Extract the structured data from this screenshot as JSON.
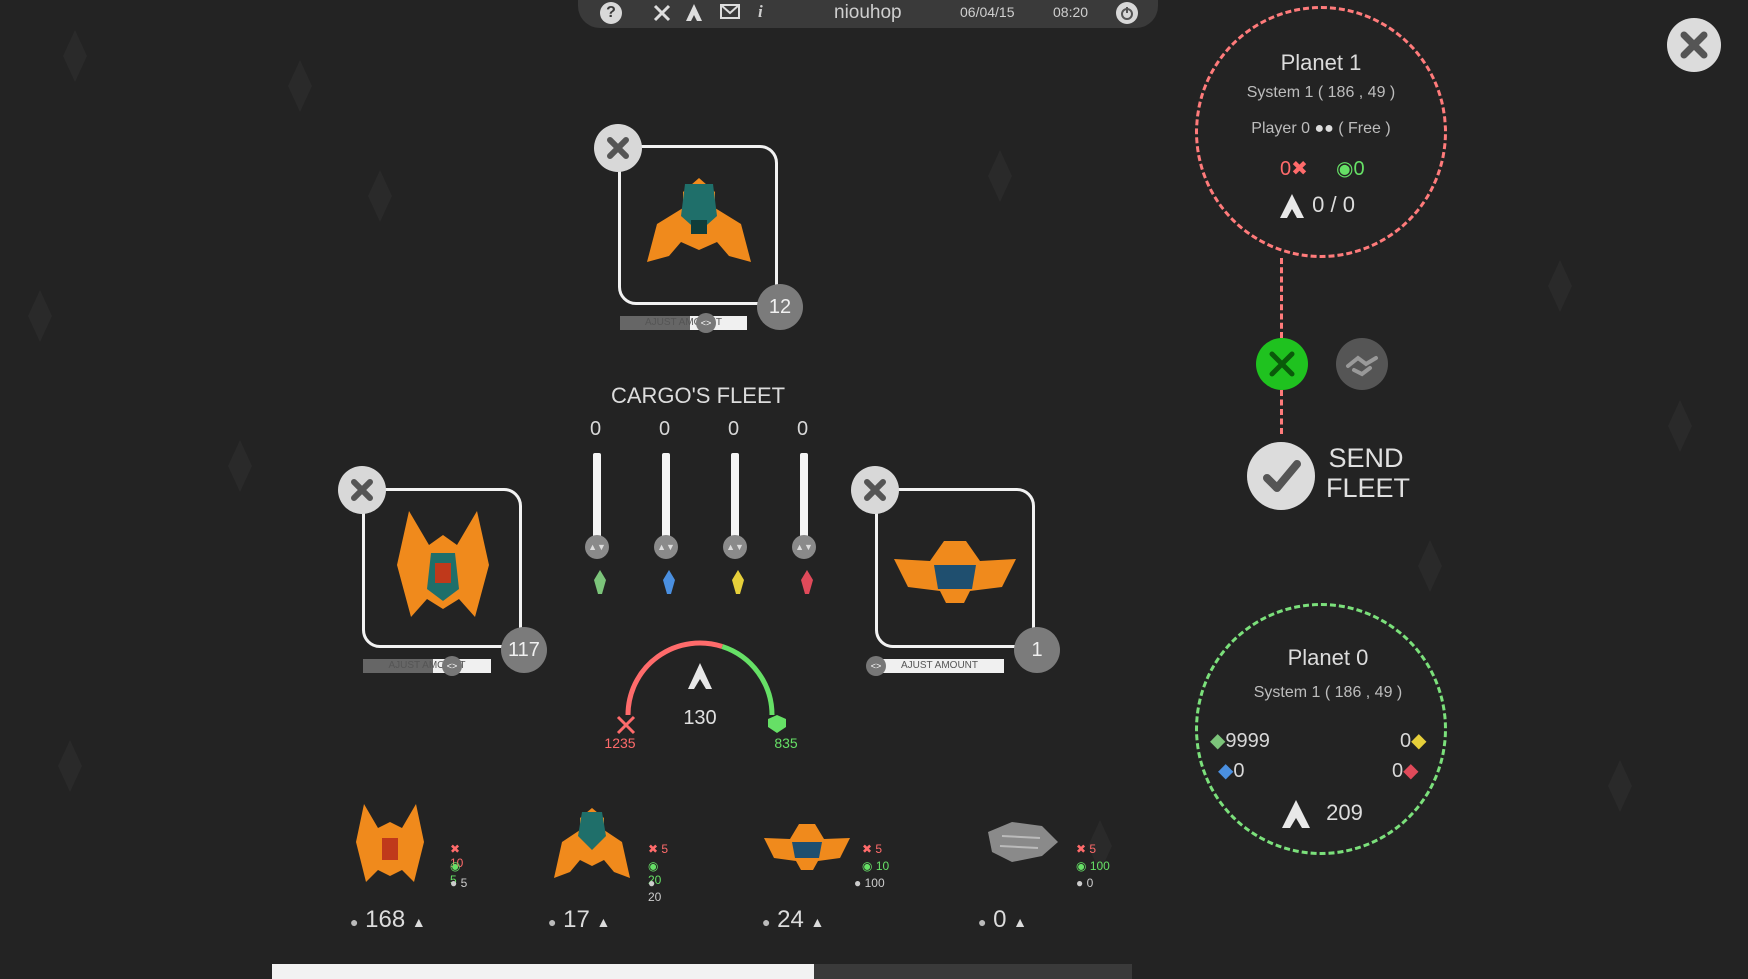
{
  "topbar": {
    "player_name": "niouhop",
    "date": "06/04/15",
    "time": "08:20"
  },
  "fleet": {
    "title": "CARGO'S FLEET",
    "slot_top": {
      "count": "12",
      "adjust_label": "AJUST AMOUNT",
      "adjust_fill": 0.55
    },
    "slot_left": {
      "count": "117",
      "adjust_label": "AJUST AMOUNT",
      "adjust_fill": 0.55
    },
    "slot_right": {
      "count": "1",
      "adjust_label": "AJUST AMOUNT",
      "adjust_fill": 0.0
    },
    "cargo_values": [
      "0",
      "0",
      "0",
      "0"
    ],
    "cargo_colors": [
      "#7cc47a",
      "#4a8fe0",
      "#e6cf3a",
      "#e04a5a"
    ],
    "attack": "1235",
    "capacity": "130",
    "defense": "835",
    "attack_share": 0.6
  },
  "ship_types": [
    {
      "attack": "10",
      "defense": "5",
      "cargo": "5",
      "available": "168"
    },
    {
      "attack": "5",
      "defense": "20",
      "cargo": "20",
      "available": "17"
    },
    {
      "attack": "5",
      "defense": "10",
      "cargo": "100",
      "available": "24"
    },
    {
      "attack": "5",
      "defense": "100",
      "cargo": "0",
      "available": "0"
    }
  ],
  "target_planet": {
    "name": "Planet 1",
    "system": "System 1 ( 186 , 49 )",
    "owner": "Player 0",
    "owner_status": "( Free )",
    "attack": "0",
    "defense": "0",
    "fleet": "0 / 0",
    "border_color": "#ff7b7b"
  },
  "origin_planet": {
    "name": "Planet 0",
    "system": "System 1 ( 186 , 49 )",
    "green_res": "9999",
    "yellow_res": "0",
    "blue_res": "0",
    "red_res": "0",
    "fleet": "209",
    "border_color": "#7be07b"
  },
  "actions": {
    "send_line1": "SEND",
    "send_line2": "FLEET"
  },
  "progress": {
    "fraction": 0.63
  },
  "colors": {
    "attack": "#ff6b6b",
    "defense": "#66e066",
    "orange": "#f08a1c",
    "teal": "#1f6f6a"
  }
}
